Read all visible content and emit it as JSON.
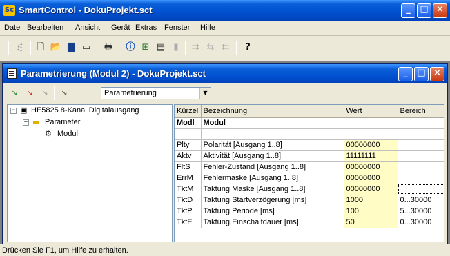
{
  "app": {
    "title": "SmartControl - DokuProjekt.sct",
    "icon_text": "Sc"
  },
  "window_buttons": {
    "minimize": "_",
    "maximize": "□",
    "close": "×"
  },
  "menu": [
    "Datei",
    "Bearbeiten",
    "Ansicht",
    "Gerät",
    "Extras",
    "Fenster",
    "Hilfe"
  ],
  "toolbar_icons": [
    "preview-icon",
    "new-icon",
    "open-icon",
    "save-icon",
    "device-icon",
    "print-icon",
    "info-icon",
    "tree-icon",
    "grid-icon",
    "panel-icon",
    "upload-icon",
    "compare-icon",
    "download-icon",
    "help-icon"
  ],
  "child": {
    "title": "Parametrierung (Modul 2) - DokuProjekt.sct",
    "view_select": "Parametrierung"
  },
  "tree": {
    "root": "HE5825 8-Kanal Digitalausgang",
    "folder": "Parameter",
    "leaf": "Modul"
  },
  "grid": {
    "headers": [
      "Kürzel",
      "Bezeichnung",
      "Wert",
      "Bereich"
    ],
    "group": {
      "kurz": "Modl",
      "bez": "Modul"
    },
    "rows": [
      {
        "kurz": "Plty",
        "bez": "Polarität [Ausgang 1..8]",
        "wert": "00000000",
        "bereich": ""
      },
      {
        "kurz": "Aktv",
        "bez": "Aktivität [Ausgang 1..8]",
        "wert": "11111111",
        "bereich": ""
      },
      {
        "kurz": "FltS",
        "bez": "Fehler-Zustand [Ausgang 1..8]",
        "wert": "00000000",
        "bereich": ""
      },
      {
        "kurz": "ErrM",
        "bez": "Fehlermaske [Ausgang 1..8]",
        "wert": "00000000",
        "bereich": ""
      },
      {
        "kurz": "TktM",
        "bez": "Taktung Maske [Ausgang 1..8]",
        "wert": "00000000",
        "bereich": ""
      },
      {
        "kurz": "TktD",
        "bez": "Taktung Startverzögerung [ms]",
        "wert": "1000",
        "bereich": "0...30000"
      },
      {
        "kurz": "TktP",
        "bez": "Taktung Periode [ms]",
        "wert": "100",
        "bereich": "5...30000"
      },
      {
        "kurz": "TktE",
        "bez": "Taktung Einschaltdauer [ms]",
        "wert": "50",
        "bereich": "0...30000"
      }
    ]
  },
  "status": "Drücken Sie F1, um Hilfe zu erhalten.",
  "colors": {
    "title_blue": "#0050d0",
    "value_bg": "#fffcc6",
    "face": "#ece9d8"
  }
}
